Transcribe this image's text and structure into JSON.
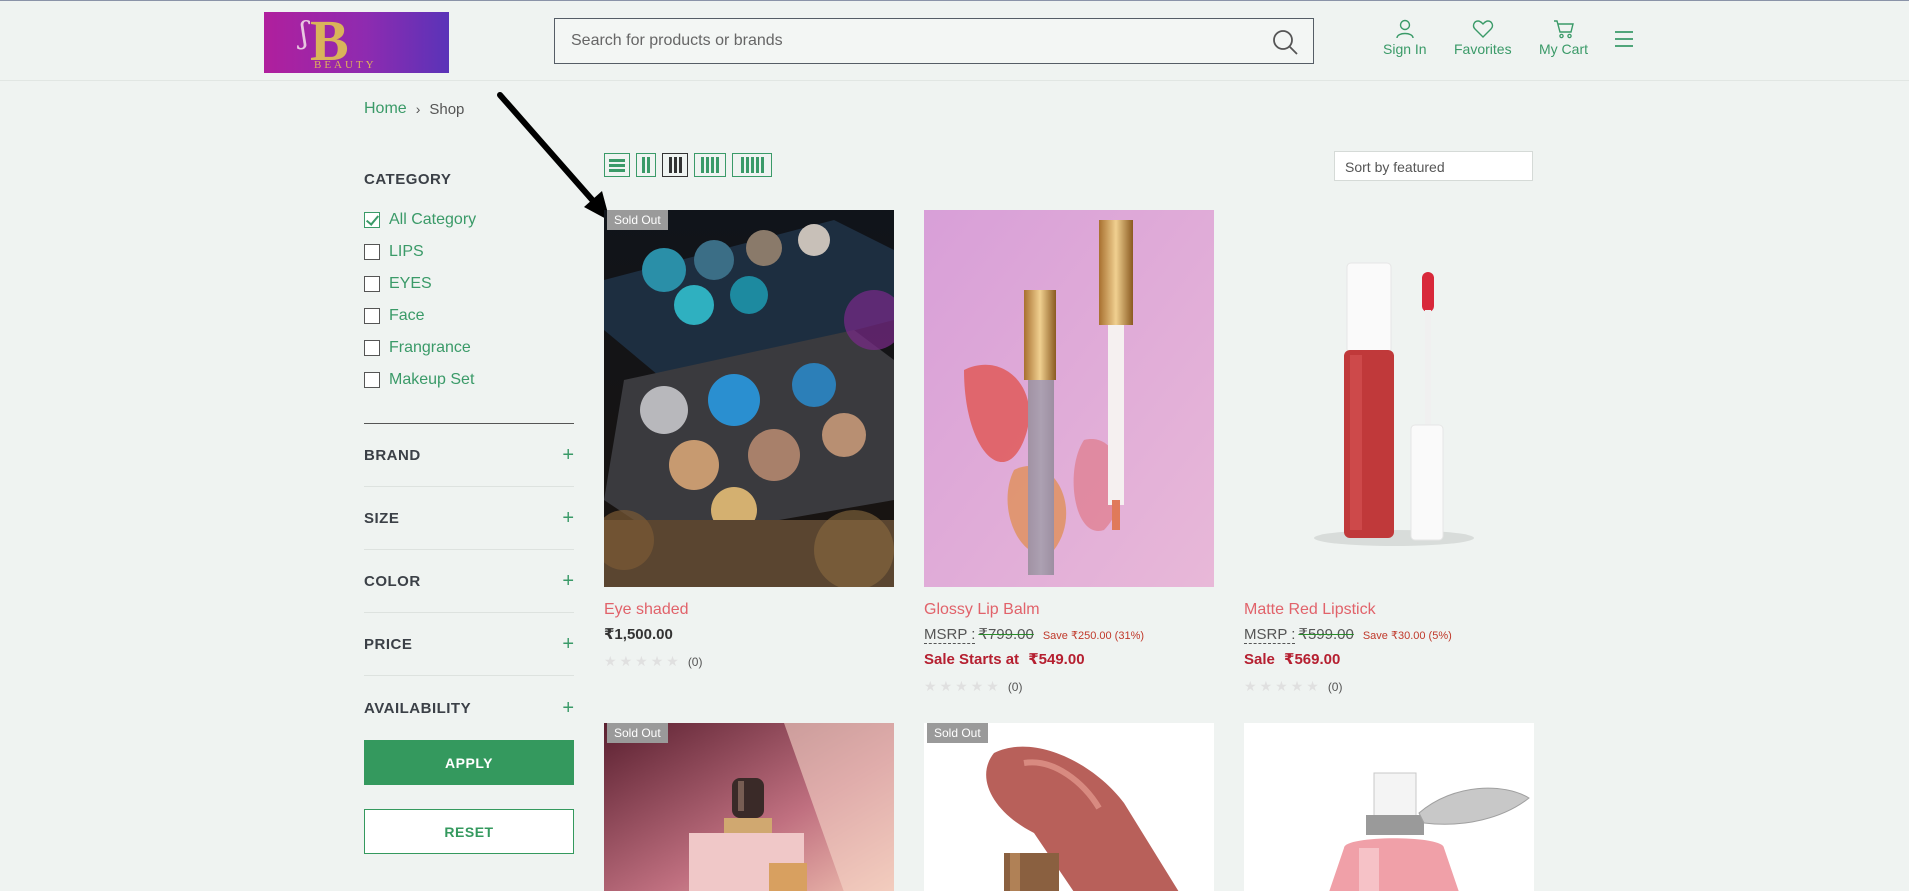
{
  "header": {
    "logo_text": "BEAUTY",
    "logo_letter": "B",
    "search_placeholder": "Search for products or brands",
    "sign_in": "Sign In",
    "favorites": "Favorites",
    "cart": "My Cart"
  },
  "breadcrumb": {
    "home": "Home",
    "sep": "›",
    "current": "Shop"
  },
  "sidebar": {
    "category_title": "CATEGORY",
    "categories": [
      {
        "label": "All Category",
        "checked": true
      },
      {
        "label": "LIPS",
        "checked": false
      },
      {
        "label": "EYES",
        "checked": false
      },
      {
        "label": "Face",
        "checked": false
      },
      {
        "label": "Frangrance",
        "checked": false
      },
      {
        "label": "Makeup Set",
        "checked": false
      }
    ],
    "filters": [
      "BRAND",
      "SIZE",
      "COLOR",
      "PRICE",
      "AVAILABILITY"
    ],
    "plus": "+",
    "apply": "APPLY",
    "reset": "RESET"
  },
  "toolbar": {
    "sort_label": "Sort by featured"
  },
  "products": [
    {
      "name": "Eye shaded",
      "price": "₹1,500.00",
      "sold_out": "Sold Out",
      "rating_count": "(0)"
    },
    {
      "name": "Glossy Lip Balm",
      "msrp_label": "MSRP :",
      "msrp_old": "₹799.00",
      "save": "Save ₹250.00 (31%)",
      "sale_label": "Sale Starts at",
      "sale_price": "₹549.00",
      "rating_count": "(0)"
    },
    {
      "name": "Matte Red Lipstick",
      "msrp_label": "MSRP :",
      "msrp_old": "₹599.00",
      "save": "Save ₹30.00 (5%)",
      "sale_label": "Sale",
      "sale_price": "₹569.00",
      "rating_count": "(0)"
    },
    {
      "sold_out": "Sold Out"
    },
    {
      "sold_out": "Sold Out"
    },
    {}
  ],
  "colors": {
    "accent": "#3a9a68",
    "product_name": "#e1626a",
    "sale": "#b51f30"
  }
}
